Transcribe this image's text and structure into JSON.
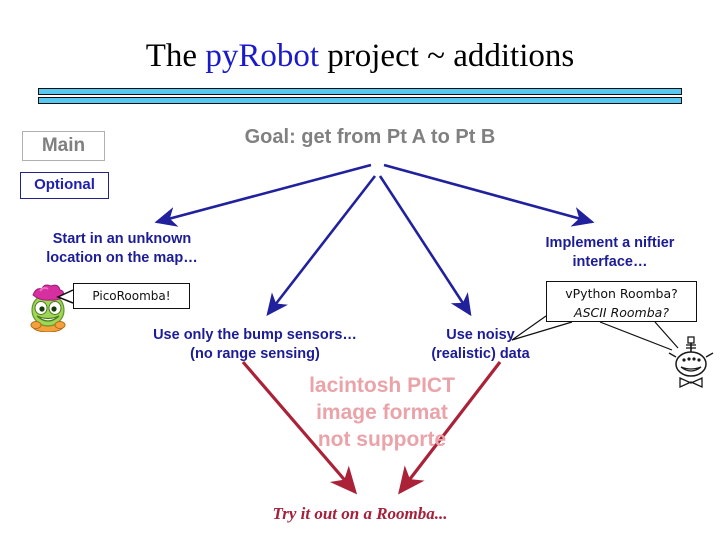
{
  "slide": {
    "title": {
      "prefix": "The ",
      "accent": "pyRobot",
      "suffix": " project ~ additions"
    },
    "legend": {
      "main": "Main",
      "optional": "Optional"
    },
    "goal": "Goal: get from Pt A to Pt B",
    "branches": {
      "left": "Start in an unknown\nlocation on the map…",
      "mid_bump": "Use only the bump sensors…\n(no range sensing)",
      "mid_noisy": "Use noisy\n(realistic) data",
      "right": "Implement a niftier\ninterface…"
    },
    "callouts": {
      "pico": "PicoRoomba!",
      "vpython_line1": "vPython Roomba?",
      "vpython_line2": "ASCII Roomba?"
    },
    "broken_image": {
      "line1": "lacintosh PICT",
      "line2": "image format",
      "line3": "not supporte"
    },
    "cta": "Try it out on a Roomba...",
    "colors": {
      "accent_blue": "#1a1acc",
      "navy": "#1c1c96",
      "gray": "#808080",
      "rule_blue": "#56c8f2",
      "dark_red": "#a5203a",
      "broken_pink": "#eaa3a8"
    }
  }
}
